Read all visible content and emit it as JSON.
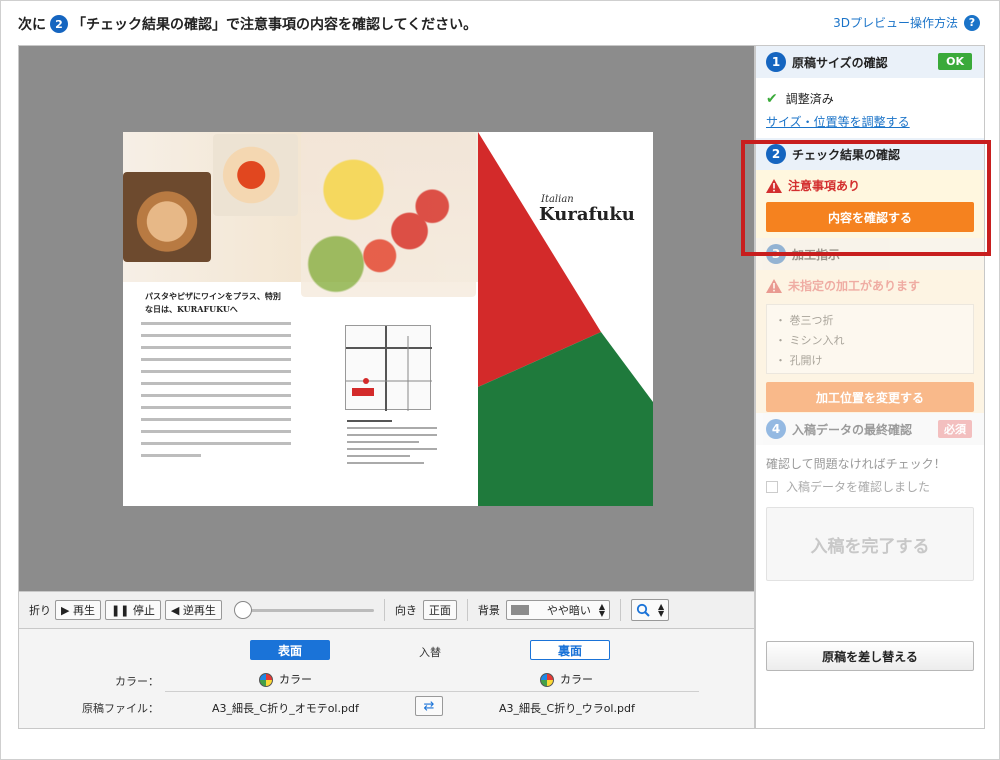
{
  "header": {
    "prefix": "次に",
    "step_number": "2",
    "instruction": "「チェック結果の確認」で注意事項の内容を確認してください。",
    "help_link": "3Dプレビュー操作方法",
    "help_icon": "question-icon"
  },
  "preview": {
    "panel_heading": "パスタやピザにワインをプラス、特別な日は、KURAFUKUへ",
    "brand_small": "Italian",
    "brand_name": "Kurafuku",
    "colors": {
      "red": "#d32a2a",
      "green": "#1f7a3c",
      "background": "#8c8c8c"
    }
  },
  "controls": {
    "fold_label": "折り",
    "play": "▶ 再生",
    "stop": "❚❚ 停止",
    "reverse": "◀ 逆再生",
    "orientation_label": "向き",
    "orientation_value": "正面",
    "background_label": "背景",
    "background_value": "やや暗い",
    "zoom_icon": "magnifier-icon"
  },
  "sides": {
    "front_label": "表面",
    "swap_label": "入替",
    "back_label": "裏面",
    "color_label": "カラー：",
    "front_color": "カラー",
    "back_color": "カラー",
    "file_label": "原稿ファイル：",
    "front_file": "A3_細長_C折り_オモテol.pdf",
    "back_file": "A3_細長_C折り_ウラol.pdf"
  },
  "sidebar": {
    "step1": {
      "number": "1",
      "title": "原稿サイズの確認",
      "badge": "OK",
      "status": "調整済み",
      "link": "サイズ・位置等を調整する"
    },
    "step2": {
      "number": "2",
      "title": "チェック結果の確認",
      "warning": "注意事項あり",
      "button": "内容を確認する"
    },
    "step3": {
      "number": "3",
      "title": "加工指示",
      "warning": "未指定の加工があります",
      "items": [
        "・ 巻三つ折",
        "・ ミシン入れ",
        "・ 孔開け"
      ],
      "button": "加工位置を変更する"
    },
    "step4": {
      "number": "4",
      "title": "入稿データの最終確認",
      "badge": "必須",
      "description": "確認して問題なければチェック！",
      "checkbox_label": "入稿データを確認しました",
      "button": "入稿を完了する"
    },
    "replace_button": "原稿を差し替える"
  }
}
